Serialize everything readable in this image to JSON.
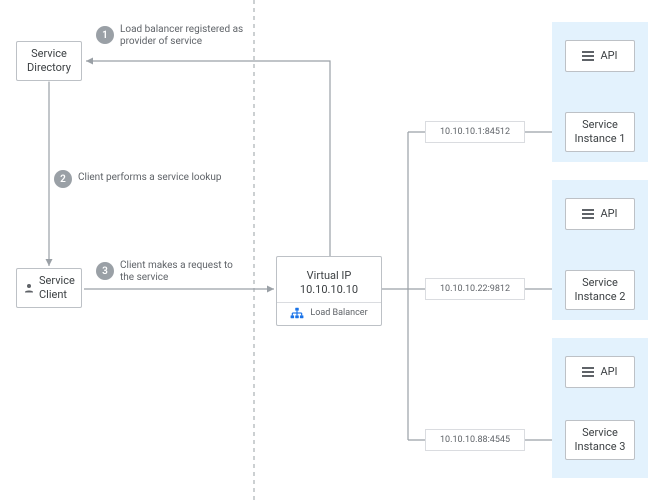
{
  "serviceDirectory": {
    "label": "Service\nDirectory"
  },
  "serviceClient": {
    "label": "Service\nClient"
  },
  "virtualIP": {
    "title": "Virtual IP",
    "address": "10.10.10.10",
    "subtitle": "Load Balancer"
  },
  "steps": {
    "s1": {
      "num": "1",
      "label": "Load balancer registered as provider of service"
    },
    "s2": {
      "num": "2",
      "label": "Client performs a service lookup"
    },
    "s3": {
      "num": "3",
      "label": "Client makes a request to the service"
    }
  },
  "ips": {
    "a": "10.10.10.1:84512",
    "b": "10.10.10.22:9812",
    "c": "10.10.10.88:4545"
  },
  "api": {
    "label": "API"
  },
  "instances": {
    "a": "Service\nInstance 1",
    "b": "Service\nInstance 2",
    "c": "Service\nInstance 3"
  },
  "chart_data": {
    "type": "diagram",
    "nodes": [
      {
        "id": "service-directory",
        "label": "Service Directory"
      },
      {
        "id": "service-client",
        "label": "Service Client"
      },
      {
        "id": "load-balancer",
        "label": "Virtual IP 10.10.10.10 / Load Balancer"
      },
      {
        "id": "api-1",
        "label": "API"
      },
      {
        "id": "instance-1",
        "label": "Service Instance 1",
        "address": "10.10.10.1:84512"
      },
      {
        "id": "api-2",
        "label": "API"
      },
      {
        "id": "instance-2",
        "label": "Service Instance 2",
        "address": "10.10.10.22:9812"
      },
      {
        "id": "api-3",
        "label": "API"
      },
      {
        "id": "instance-3",
        "label": "Service Instance 3",
        "address": "10.10.10.88:4545"
      }
    ],
    "edges": [
      {
        "from": "load-balancer",
        "to": "service-directory",
        "step": 1,
        "label": "Load balancer registered as provider of service"
      },
      {
        "from": "service-client",
        "to": "service-directory",
        "step": 2,
        "label": "Client performs a service lookup",
        "bidirectional": true
      },
      {
        "from": "service-client",
        "to": "load-balancer",
        "step": 3,
        "label": "Client makes a request to the service"
      },
      {
        "from": "load-balancer",
        "to": "instance-1"
      },
      {
        "from": "load-balancer",
        "to": "instance-2"
      },
      {
        "from": "load-balancer",
        "to": "instance-3"
      }
    ]
  }
}
